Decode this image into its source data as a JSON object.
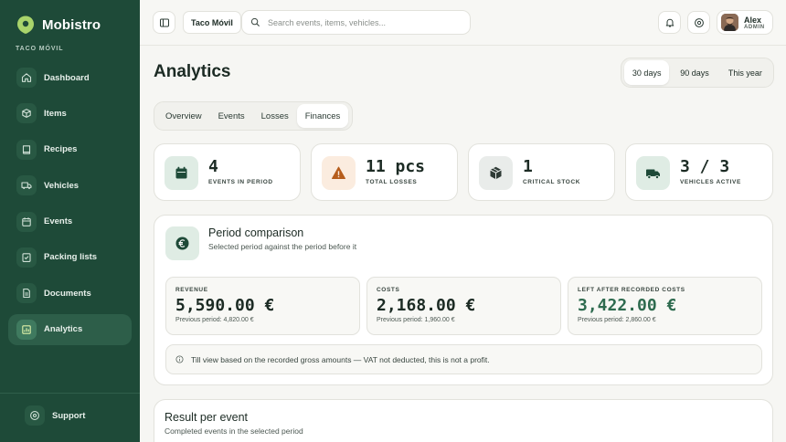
{
  "brand": {
    "name": "Mobistro",
    "subtitle": "TACO MÓVIL"
  },
  "sidebar": {
    "items": [
      {
        "label": "Dashboard",
        "icon": "home-icon"
      },
      {
        "label": "Items",
        "icon": "box-icon"
      },
      {
        "label": "Recipes",
        "icon": "book-icon"
      },
      {
        "label": "Vehicles",
        "icon": "truck-icon"
      },
      {
        "label": "Events",
        "icon": "calendar-icon"
      },
      {
        "label": "Packing lists",
        "icon": "checklist-icon"
      },
      {
        "label": "Documents",
        "icon": "document-icon"
      },
      {
        "label": "Analytics",
        "icon": "chart-icon",
        "active": true
      }
    ],
    "support_label": "Support"
  },
  "topbar": {
    "workspace_chip": "Taco Móvil",
    "search_placeholder": "Search events, items, vehicles...",
    "user": {
      "name": "Alex",
      "role": "ADMIN"
    }
  },
  "page": {
    "title": "Analytics"
  },
  "range": {
    "options": [
      "30 days",
      "90 days",
      "This year"
    ],
    "selected": "30 days"
  },
  "tabs": {
    "items": [
      "Overview",
      "Events",
      "Losses",
      "Finances"
    ],
    "selected": "Finances"
  },
  "stats": [
    {
      "value": "4",
      "label": "EVENTS IN PERIOD",
      "icon": "calendar-icon",
      "tint": "#dfece4"
    },
    {
      "value": "11 pcs",
      "label": "TOTAL LOSSES",
      "icon": "warning-icon",
      "tint": "#fbecdf"
    },
    {
      "value": "1",
      "label": "CRITICAL STOCK",
      "icon": "cube-icon",
      "tint": "#e9ecea"
    },
    {
      "value": "3 / 3",
      "label": "VEHICLES ACTIVE",
      "icon": "truck-icon",
      "tint": "#dfece4"
    }
  ],
  "comparison": {
    "title": "Period comparison",
    "subtitle": "Selected period against the period before it",
    "metrics": [
      {
        "label": "REVENUE",
        "value": "5,590.00 €",
        "previous": "Previous period: 4,820.00 €"
      },
      {
        "label": "COSTS",
        "value": "2,168.00 €",
        "previous": "Previous period: 1,960.00 €"
      },
      {
        "label": "LEFT AFTER RECORDED COSTS",
        "value": "3,422.00 €",
        "previous": "Previous period: 2,860.00 €"
      }
    ],
    "note": "Till view based on the recorded gross amounts — VAT not deducted, this is not a profit."
  },
  "result": {
    "title": "Result per event",
    "subtitle": "Completed events in the selected period"
  },
  "colors": {
    "sidebar": "#1e4a38",
    "accent_green": "#2e6b4f",
    "warning_orange": "#b65d1c"
  }
}
